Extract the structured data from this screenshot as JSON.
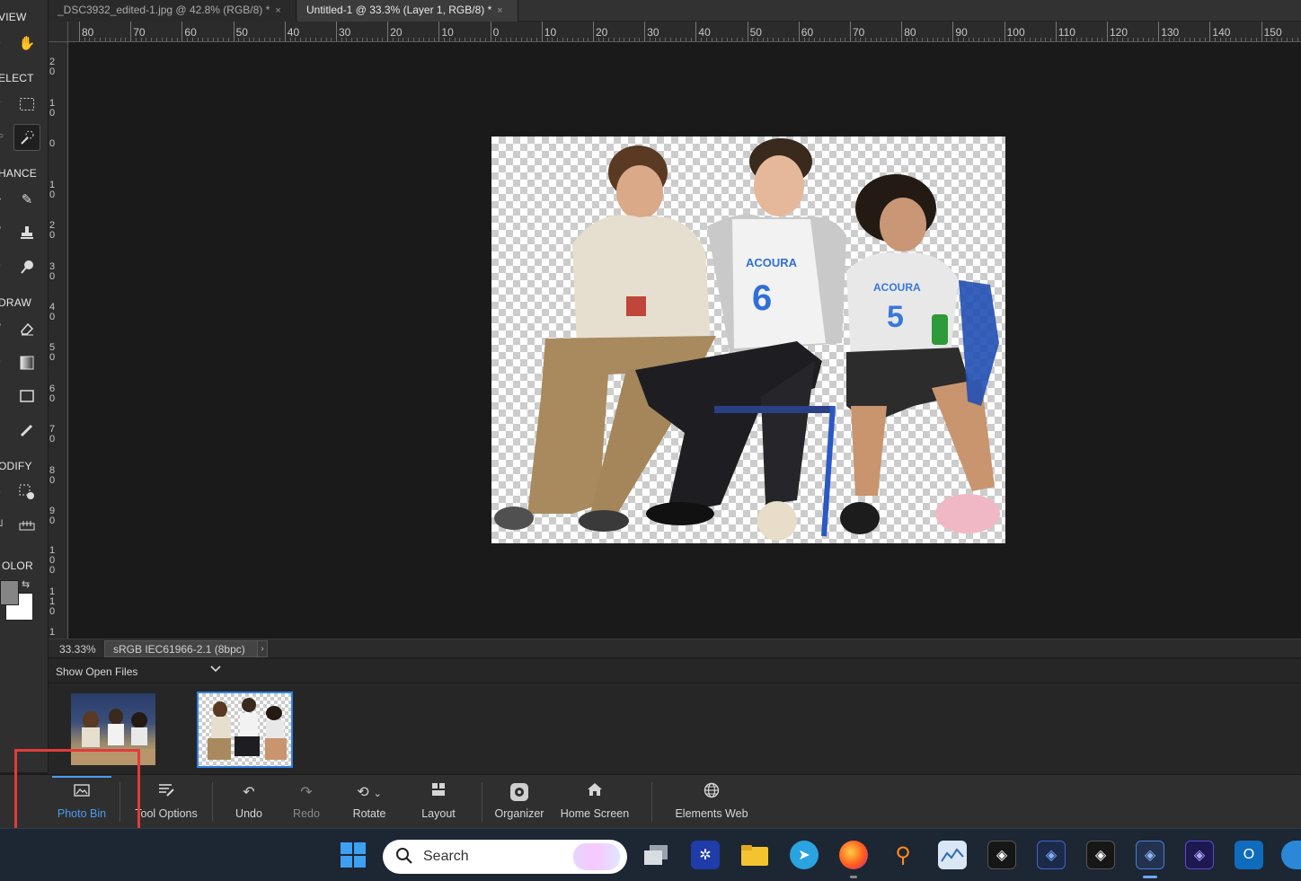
{
  "tabs": [
    {
      "label": "_DSC3932_edited-1.jpg @ 42.8% (RGB/8) *",
      "close": "×"
    },
    {
      "label": "Untitled-1 @ 33.3% (Layer 1, RGB/8) *",
      "close": "×"
    }
  ],
  "toolbar": {
    "sections": {
      "view": "VIEW",
      "select": "ELECT",
      "enhance": "HANCE",
      "draw": "DRAW",
      "modify": "ODIFY",
      "color": "OLOR"
    },
    "foreground_color": "#858585",
    "background_color": "#ffffff"
  },
  "ruler_top_labels": [
    "80",
    "70",
    "60",
    "50",
    "40",
    "30",
    "20",
    "10",
    "0",
    "10",
    "20",
    "30",
    "40",
    "50",
    "60",
    "70",
    "80",
    "90",
    "100",
    "110",
    "120",
    "130",
    "140",
    "150"
  ],
  "ruler_left_labels": [
    "20",
    "10",
    "0",
    "10",
    "20",
    "30",
    "40",
    "50",
    "60",
    "70",
    "80",
    "90",
    "100",
    "110",
    "1"
  ],
  "status": {
    "zoom": "33.33%",
    "profile": "sRGB IEC61966-2.1 (8bpc)",
    "arrow": "›"
  },
  "photo_bin": {
    "dropdown_value": "Show Open Files",
    "items": [
      "_DSC3932_edited-1.jpg",
      "Untitled-1"
    ]
  },
  "panel_buttons": {
    "photo_bin": "Photo Bin",
    "tool_options": "Tool Options",
    "undo": "Undo",
    "redo": "Redo",
    "rotate": "Rotate",
    "layout": "Layout",
    "organizer": "Organizer",
    "home_screen": "Home Screen",
    "elements_web": "Elements Web"
  },
  "taskbar": {
    "search_placeholder": "Search"
  },
  "colors": {
    "accent": "#4a9cf2",
    "highlight_box": "#e33b3b"
  }
}
